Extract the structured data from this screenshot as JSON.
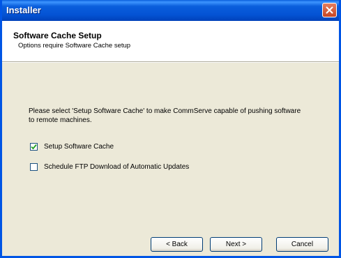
{
  "window": {
    "title": "Installer"
  },
  "header": {
    "title": "Software Cache Setup",
    "subtitle": "Options require Software Cache setup"
  },
  "body": {
    "description": "Please select 'Setup Software Cache' to make CommServe capable of pushing software to remote machines.",
    "options": [
      {
        "label": "Setup Software Cache",
        "checked": true
      },
      {
        "label": "Schedule FTP Download of Automatic Updates",
        "checked": false
      }
    ]
  },
  "buttons": {
    "back": "< Back",
    "next": "Next >",
    "cancel": "Cancel"
  },
  "colors": {
    "titlebar": "#0453d4",
    "dialog_bg": "#ece9d8",
    "close_button": "#c64524"
  }
}
